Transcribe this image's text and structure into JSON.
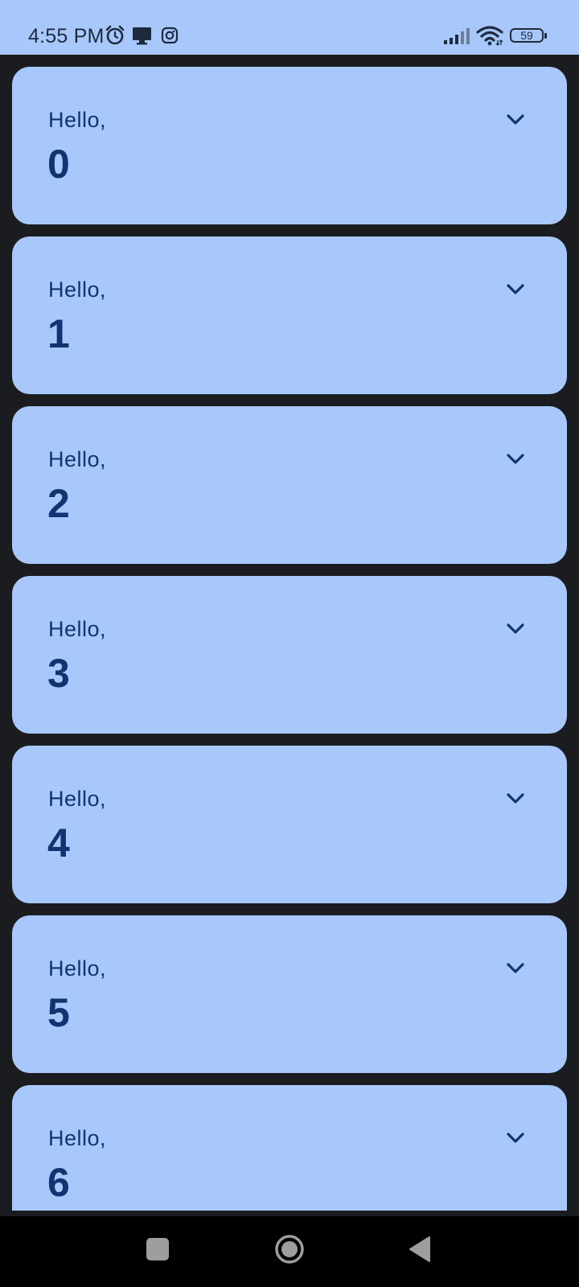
{
  "status_bar": {
    "time": "4:55 PM",
    "battery_level": "59",
    "icons": [
      "alarm-icon",
      "cast-screen-icon",
      "instagram-icon",
      "signal-icon",
      "wifi-icon",
      "battery-icon"
    ]
  },
  "cards": [
    {
      "greeting": "Hello,",
      "number": "0"
    },
    {
      "greeting": "Hello,",
      "number": "1"
    },
    {
      "greeting": "Hello,",
      "number": "2"
    },
    {
      "greeting": "Hello,",
      "number": "3"
    },
    {
      "greeting": "Hello,",
      "number": "4"
    },
    {
      "greeting": "Hello,",
      "number": "5"
    },
    {
      "greeting": "Hello,",
      "number": "6"
    }
  ],
  "colors": {
    "accent": "#a8c8fc",
    "background": "#1b1c20",
    "text": "#0f3471"
  },
  "nav_bar": {
    "icons": [
      "recents-icon",
      "home-icon",
      "back-icon"
    ]
  }
}
